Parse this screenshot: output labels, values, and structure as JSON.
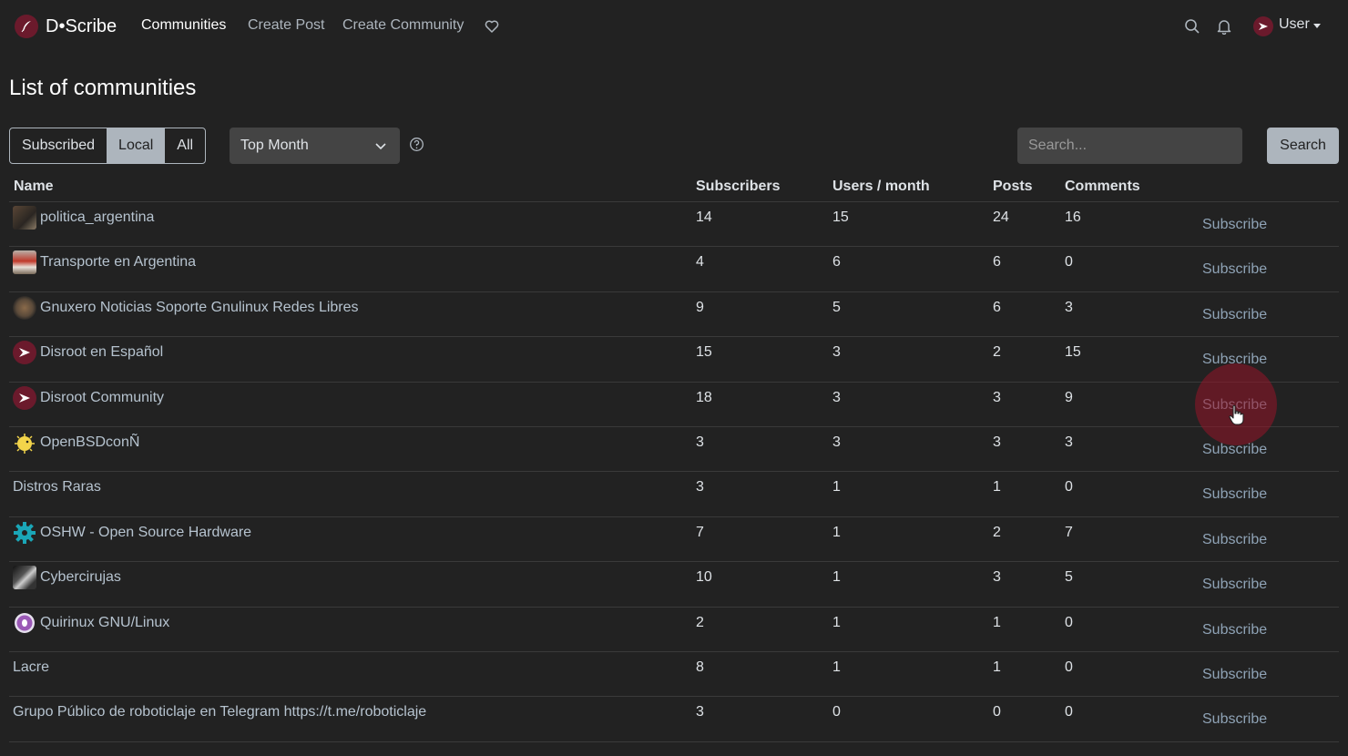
{
  "app": {
    "brand": "D•Scribe",
    "nav": {
      "communities": "Communities",
      "create_post": "Create Post",
      "create_community": "Create Community"
    },
    "user_label": "User",
    "icons": {
      "brand": "quill-logo-icon",
      "donate": "heart-icon",
      "search": "search-icon",
      "notifications": "bell-icon",
      "user": "user-avatar-icon",
      "help": "question-circle-icon"
    },
    "colors": {
      "background": "#222222",
      "brand": "#6b1a2c",
      "link": "#b6c3cf",
      "subscribe": "#8fa3b6",
      "active_segment": "#adb5bd"
    }
  },
  "page": {
    "title": "List of communities",
    "filters": {
      "segments": [
        "Subscribed",
        "Local",
        "All"
      ],
      "active_segment": "Local",
      "sort_selected": "Top Month"
    },
    "search": {
      "placeholder": "Search...",
      "button_label": "Search"
    }
  },
  "table": {
    "headers": {
      "name": "Name",
      "subscribers": "Subscribers",
      "users_month": "Users / month",
      "posts": "Posts",
      "comments": "Comments"
    },
    "subscribe_label": "Subscribe",
    "rows": [
      {
        "name": "politica_argentina",
        "icon": "photo",
        "subscribers": "14",
        "users_month": "15",
        "posts": "24",
        "comments": "16"
      },
      {
        "name": "Transporte en Argentina",
        "icon": "bus-photo",
        "subscribers": "4",
        "users_month": "6",
        "posts": "6",
        "comments": "0"
      },
      {
        "name": "Gnuxero Noticias Soporte Gnulinux Redes Libres",
        "icon": "gnu-photo",
        "subscribers": "9",
        "users_month": "5",
        "posts": "6",
        "comments": "3"
      },
      {
        "name": "Disroot en Español",
        "icon": "disroot",
        "subscribers": "15",
        "users_month": "3",
        "posts": "2",
        "comments": "15"
      },
      {
        "name": "Disroot Community",
        "icon": "disroot",
        "subscribers": "18",
        "users_month": "3",
        "posts": "3",
        "comments": "9"
      },
      {
        "name": "OpenBSDconÑ",
        "icon": "puffer",
        "subscribers": "3",
        "users_month": "3",
        "posts": "3",
        "comments": "3"
      },
      {
        "name": "Distros Raras",
        "icon": "none",
        "subscribers": "3",
        "users_month": "1",
        "posts": "1",
        "comments": "0"
      },
      {
        "name": "OSHW - Open Source Hardware",
        "icon": "gear",
        "subscribers": "7",
        "users_month": "1",
        "posts": "2",
        "comments": "7"
      },
      {
        "name": "Cybercirujas",
        "icon": "photo-dark",
        "subscribers": "10",
        "users_month": "1",
        "posts": "3",
        "comments": "5"
      },
      {
        "name": "Quirinux GNU/Linux",
        "icon": "quirinux",
        "subscribers": "2",
        "users_month": "1",
        "posts": "1",
        "comments": "0"
      },
      {
        "name": "Lacre",
        "icon": "none",
        "subscribers": "8",
        "users_month": "1",
        "posts": "1",
        "comments": "0"
      },
      {
        "name": "Grupo Público de roboticlaje en Telegram https://t.me/roboticlaje",
        "icon": "none",
        "subscribers": "3",
        "users_month": "0",
        "posts": "0",
        "comments": "0"
      }
    ]
  }
}
